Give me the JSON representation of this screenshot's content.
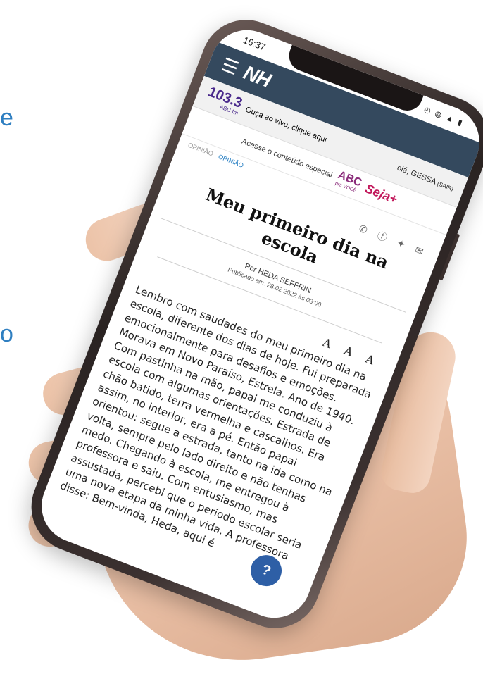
{
  "edge_chars": [
    "e",
    "o"
  ],
  "status": {
    "time": "16:37",
    "icons": "◴ ◍ ▲ ▮"
  },
  "nav": {
    "menu_glyph": "☰",
    "logo": "NH"
  },
  "radio": {
    "frequency": "103.3",
    "station": "ABC fm",
    "text": "Ouça ao vivo, clique aqui"
  },
  "user": {
    "greeting": "olá, GESSA",
    "logout": "(SAIR)"
  },
  "promo": {
    "text": "Acesse o conteúdo especial",
    "abc": "ABC",
    "abc_sub": "pra VOCÊ",
    "seja": "Seja+"
  },
  "breadcrumb": {
    "section": "OPINIÃO",
    "active": "OPINIÃO"
  },
  "share_icons": [
    "whatsapp-icon",
    "facebook-icon",
    "twitter-icon",
    "email-icon"
  ],
  "share_glyphs": "✆ ⓕ ✦ ✉",
  "article": {
    "title": "Meu primeiro dia na escola",
    "author": "Por HEDA SEFFRIN",
    "published": "Publicado em: 28.02.2022 às 03:00",
    "font_controls": "A A A",
    "body": "Lembro com saudades do meu primeiro dia na escola, diferente dos dias de hoje. Fui preparada emocionalmente para desafios e emoções. Morava em Novo Paraíso, Estrela. Ano de 1940. Com pastinha na mão, papai me conduziu à escola com algumas orientações. Estrada de chão batido, terra vermelha e cascalhos. Era assim, no interior, era a pé. Então papai orientou: segue a estrada, tanto na ida como na volta, sempre pelo lado direito e não tenhas medo. Chegando à escola, me entregou à professora e saiu. Com entusiasmo, mas assustada, percebi que o período escolar seria uma nova etapa da minha vida. A professora disse: Bem-vinda, Heda, aqui é"
  },
  "help_glyph": "?",
  "colors": {
    "navbar": "#34495e",
    "accent": "#1f7ac0",
    "radio": "#4a2a8c"
  }
}
